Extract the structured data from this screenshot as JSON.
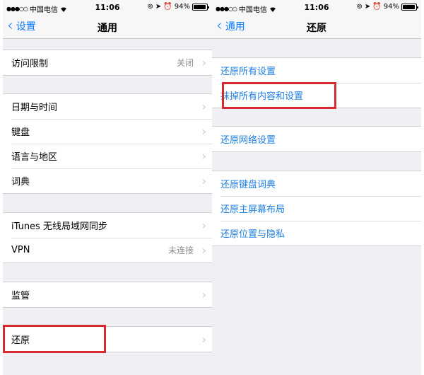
{
  "status_bar": {
    "carrier": "中国电信",
    "time": "11:06",
    "battery": "94%"
  },
  "left": {
    "back_label": "设置",
    "title": "通用",
    "groups": [
      [
        {
          "label": "访问限制",
          "detail": "关闭"
        }
      ],
      [
        {
          "label": "日期与时间"
        },
        {
          "label": "键盘"
        },
        {
          "label": "语言与地区"
        },
        {
          "label": "词典"
        }
      ],
      [
        {
          "label": "iTunes 无线局域网同步"
        },
        {
          "label": "VPN",
          "detail": "未连接"
        }
      ],
      [
        {
          "label": "监管"
        }
      ],
      [
        {
          "label": "还原"
        }
      ]
    ]
  },
  "right": {
    "back_label": "通用",
    "title": "还原",
    "groups": [
      [
        {
          "label": "还原所有设置"
        },
        {
          "label": "抹掉所有内容和设置"
        }
      ],
      [
        {
          "label": "还原网络设置"
        }
      ],
      [
        {
          "label": "还原键盘词典"
        },
        {
          "label": "还原主屏幕布局"
        },
        {
          "label": "还原位置与隐私"
        }
      ]
    ]
  },
  "colors": {
    "accent": "#0a7aff",
    "link_text": "#1e7fe0",
    "highlight": "#d62b30",
    "background": "#efeff4"
  }
}
